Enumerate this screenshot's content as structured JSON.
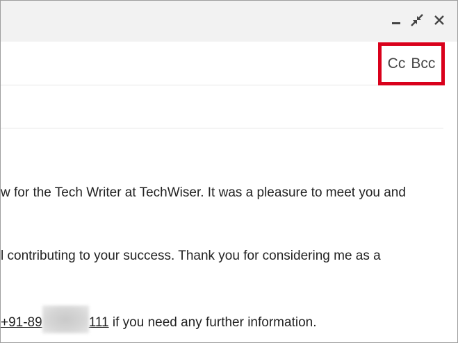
{
  "compose": {
    "cc_label": "Cc",
    "bcc_label": "Bcc",
    "icons": {
      "minimize": "minimize-icon",
      "popout": "exit-fullscreen-icon",
      "close": "close-icon"
    },
    "highlight_color": "#d9001b"
  },
  "body": {
    "line1": "w for the Tech Writer at TechWiser. It was a pleasure to meet you and",
    "line2": "l contributing to your success. Thank you for considering me as a",
    "line3": {
      "phone_start": "+91-89",
      "phone_end": "111",
      "rest": " if you need any further information."
    }
  }
}
